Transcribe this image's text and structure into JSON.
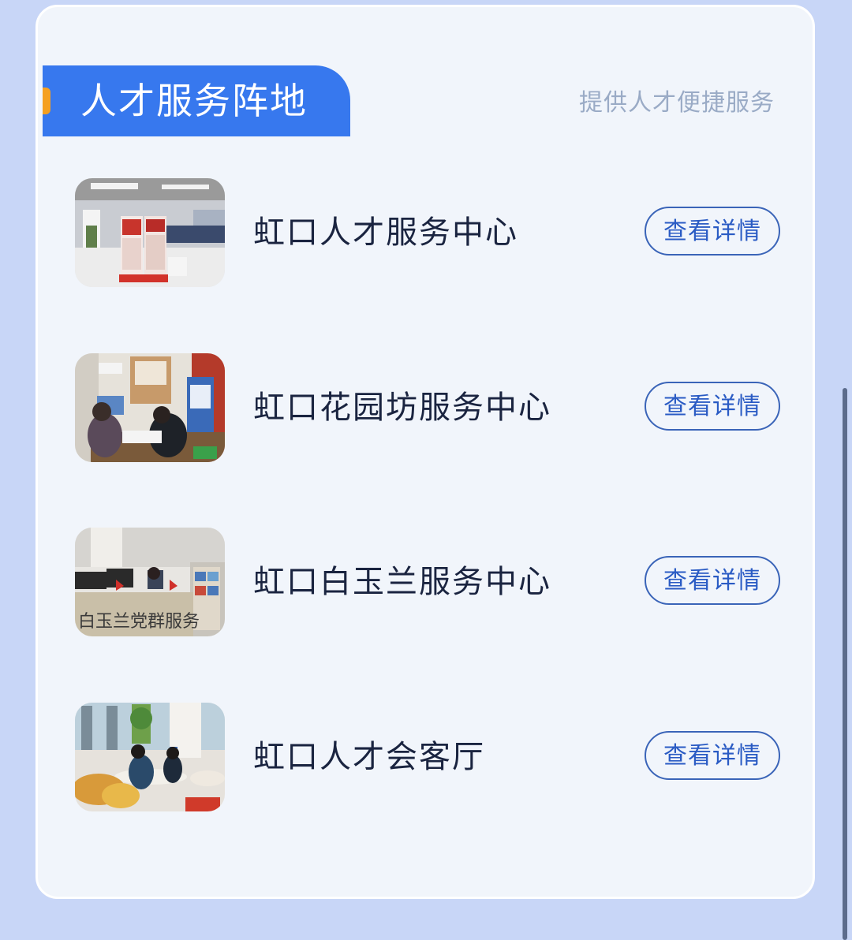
{
  "section": {
    "title": "人才服务阵地",
    "subtitle": "提供人才便捷服务"
  },
  "items": [
    {
      "title": "虹口人才服务中心",
      "button_label": "查看详情"
    },
    {
      "title": "虹口花园坊服务中心",
      "button_label": "查看详情"
    },
    {
      "title": "虹口白玉兰服务中心",
      "button_label": "查看详情"
    },
    {
      "title": "虹口人才会客厅",
      "button_label": "查看详情"
    }
  ],
  "thumbnails": {
    "item3_sign_text": "白玉兰党群服务"
  },
  "colors": {
    "accent": "#3778ee",
    "tab_marker": "#f5a020",
    "button_border": "#3a64b8",
    "card_background": "#f1f5fb",
    "page_background": "#c8d6f7"
  }
}
